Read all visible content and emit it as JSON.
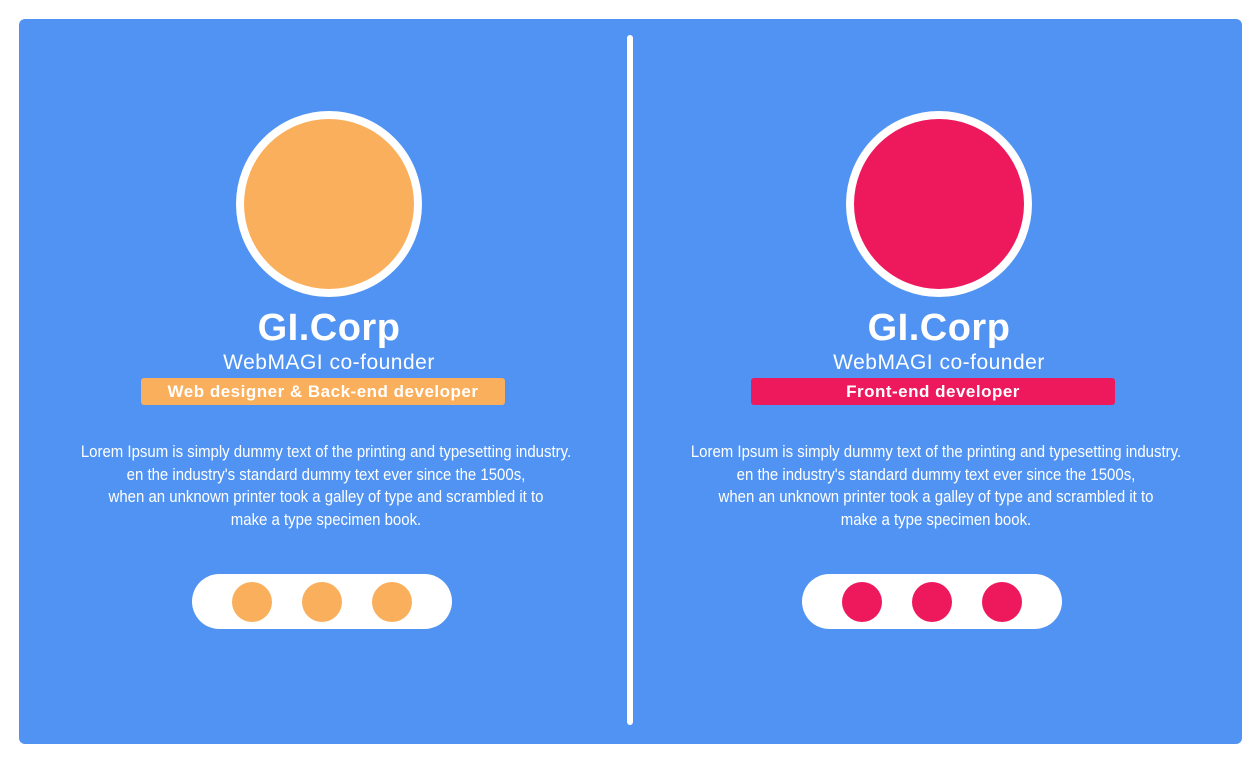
{
  "colors": {
    "background": "#5093f3",
    "white": "#ffffff"
  },
  "cards": [
    {
      "accent": "#faaf5c",
      "name": "GI.Corp",
      "subtitle": "WebMAGI co-founder",
      "role": "Web designer & Back-end developer",
      "description": [
        "Lorem Ipsum is simply dummy text of the printing and typesetting industry.",
        "en the industry's standard dummy text ever since the 1500s,",
        "when an unknown printer took a galley of type and scrambled it to",
        "make a type specimen book."
      ]
    },
    {
      "accent": "#ee185d",
      "name": "GI.Corp",
      "subtitle": "WebMAGI co-founder",
      "role": "Front-end developer",
      "description": [
        "Lorem Ipsum is simply dummy text of the printing and typesetting industry.",
        "en the industry's standard dummy text ever since the 1500s,",
        "when an unknown printer took a galley of type and scrambled it to",
        "make a type specimen book."
      ]
    }
  ]
}
